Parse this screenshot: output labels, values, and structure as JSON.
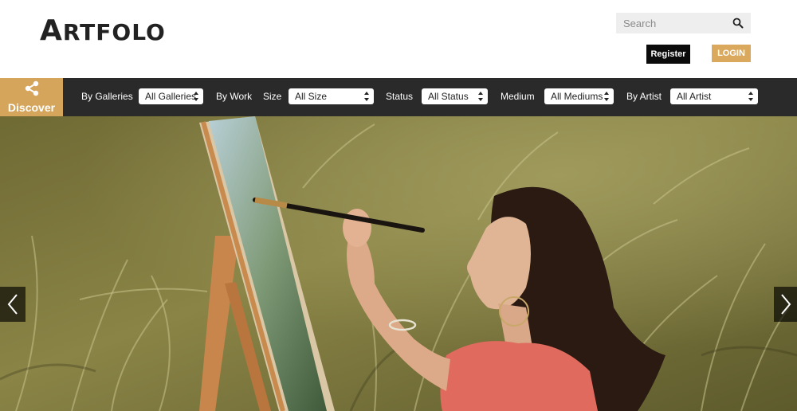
{
  "header": {
    "logo_first": "A",
    "logo_rest": "RTFOLO",
    "search_placeholder": "Search",
    "register_label": "Register",
    "login_label": "LOGIN"
  },
  "filters": {
    "discover_label": "Discover",
    "by_galleries_label": "By Galleries",
    "galleries_value": "All Galleries",
    "by_work_label": "By Work",
    "size_label": "Size",
    "size_value": "All Size",
    "status_label": "Status",
    "status_value": "All Status",
    "medium_label": "Medium",
    "medium_value": "All Mediums",
    "by_artist_label": "By Artist",
    "artist_value": "All Artist"
  },
  "colors": {
    "accent": "#d5a55b",
    "login_bg": "#dba95d",
    "bar_bg": "#2a2a2a",
    "register_bg": "#0b0b0b"
  },
  "icons": {
    "search": "search-icon",
    "share": "share-icon",
    "prev": "chevron-left-icon",
    "next": "chevron-right-icon"
  }
}
